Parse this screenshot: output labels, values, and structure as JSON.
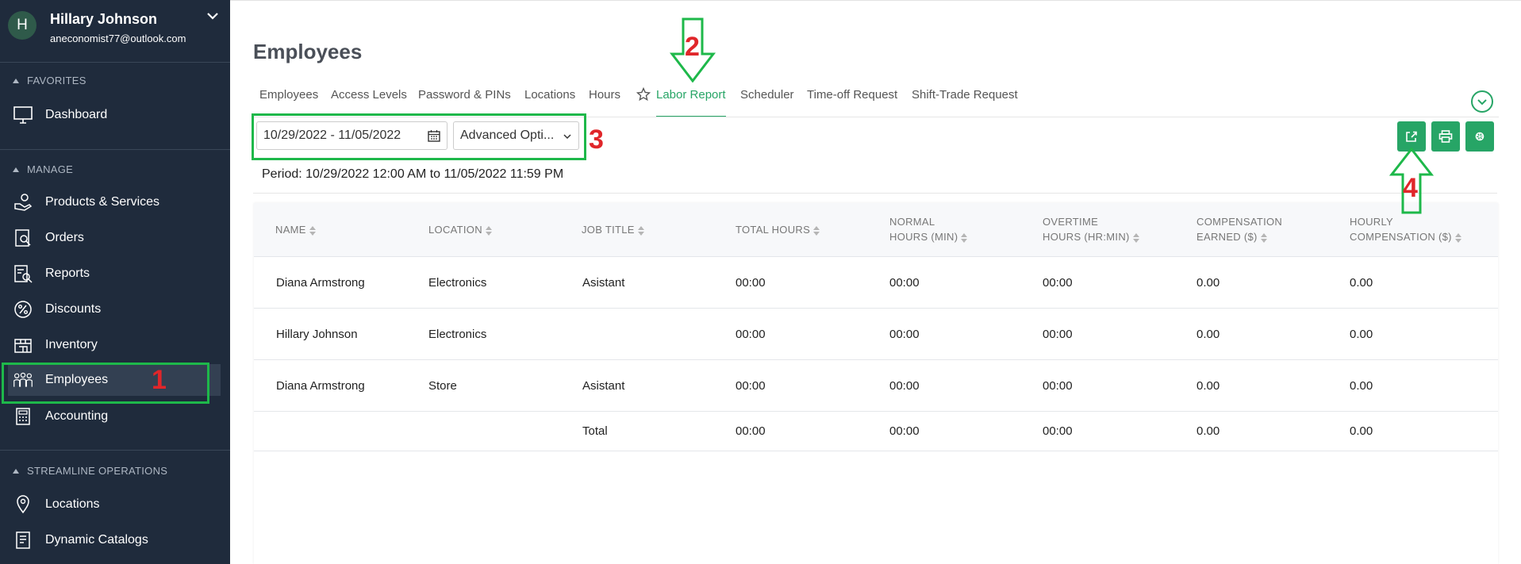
{
  "user": {
    "initial": "H",
    "name": "Hillary Johnson",
    "email": "aneconomist77@outlook.com"
  },
  "sidebar": {
    "favorites_title": "FAVORITES",
    "manage_title": "MANAGE",
    "streamline_title": "STREAMLINE OPERATIONS",
    "favorites": [
      {
        "label": "Dashboard"
      }
    ],
    "manage": [
      {
        "label": "Products & Services"
      },
      {
        "label": "Orders"
      },
      {
        "label": "Reports"
      },
      {
        "label": "Discounts"
      },
      {
        "label": "Inventory"
      },
      {
        "label": "Employees"
      },
      {
        "label": "Accounting"
      }
    ],
    "streamline": [
      {
        "label": "Locations"
      },
      {
        "label": "Dynamic Catalogs"
      }
    ]
  },
  "page": {
    "title": "Employees"
  },
  "tabs": [
    {
      "label": "Employees"
    },
    {
      "label": "Access Levels"
    },
    {
      "label": "Password & PINs"
    },
    {
      "label": "Locations"
    },
    {
      "label": "Hours"
    },
    {
      "label": "Labor Report"
    },
    {
      "label": "Scheduler"
    },
    {
      "label": "Time-off Request"
    },
    {
      "label": "Shift-Trade Request"
    }
  ],
  "filters": {
    "date_range": "10/29/2022 - 11/05/2022",
    "advanced_options": "Advanced Opti..."
  },
  "period": {
    "label": "Period:",
    "value": "10/29/2022 12:00 AM to 11/05/2022 11:59 PM"
  },
  "table": {
    "headers": [
      {
        "line1": "NAME",
        "line2": ""
      },
      {
        "line1": "LOCATION",
        "line2": ""
      },
      {
        "line1": "JOB TITLE",
        "line2": ""
      },
      {
        "line1": "TOTAL HOURS",
        "line2": ""
      },
      {
        "line1": "NORMAL",
        "line2": "HOURS (MIN)"
      },
      {
        "line1": "OVERTIME",
        "line2": "HOURS (HR:MIN)"
      },
      {
        "line1": "COMPENSATION",
        "line2": "EARNED ($)"
      },
      {
        "line1": "HOURLY",
        "line2": "COMPENSATION ($)"
      }
    ],
    "rows": [
      [
        "Diana Armstrong",
        "Electronics",
        "Asistant",
        "00:00",
        "00:00",
        "00:00",
        "0.00",
        "0.00"
      ],
      [
        "Hillary Johnson",
        "Electronics",
        "",
        "00:00",
        "00:00",
        "00:00",
        "0.00",
        "0.00"
      ],
      [
        "Diana Armstrong",
        "Store",
        "Asistant",
        "00:00",
        "00:00",
        "00:00",
        "0.00",
        "0.00"
      ]
    ],
    "total": [
      "",
      "",
      "Total",
      "00:00",
      "00:00",
      "00:00",
      "0.00",
      "0.00"
    ]
  },
  "annotations": {
    "n1": "1",
    "n2": "2",
    "n3": "3",
    "n4": "4"
  },
  "colors": {
    "accent": "#27a566",
    "sidebar_bg": "#1f2b3c",
    "annotation_box": "#1eb84a",
    "annotation_number": "#e0262a"
  }
}
